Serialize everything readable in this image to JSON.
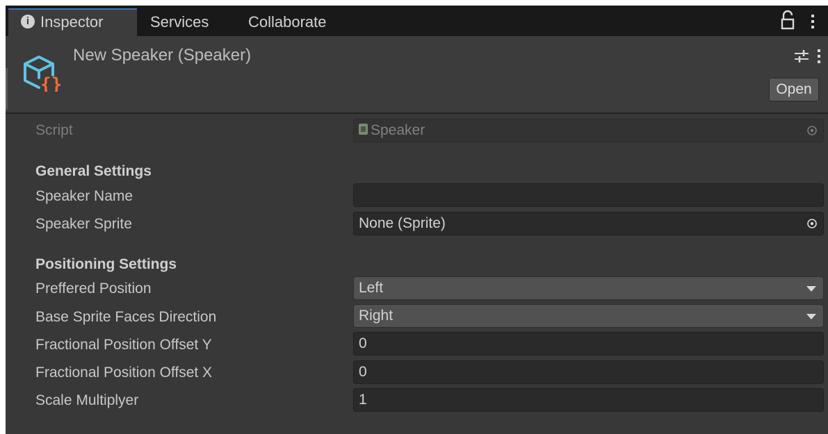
{
  "tabs": [
    {
      "label": "Inspector"
    },
    {
      "label": "Services"
    },
    {
      "label": "Collaborate"
    }
  ],
  "header": {
    "title": "New Speaker (Speaker)",
    "open_label": "Open"
  },
  "script_row": {
    "label": "Script",
    "value": "Speaker"
  },
  "general_settings": {
    "heading": "General Settings",
    "speaker_name": {
      "label": "Speaker Name",
      "value": ""
    },
    "speaker_sprite": {
      "label": "Speaker Sprite",
      "value": "None (Sprite)"
    }
  },
  "positioning_settings": {
    "heading": "Positioning Settings",
    "preferred_position": {
      "label": "Preffered Position",
      "value": "Left"
    },
    "base_sprite_faces": {
      "label": "Base Sprite Faces Direction",
      "value": "Right"
    },
    "offset_y": {
      "label": "Fractional Position Offset Y",
      "value": "0"
    },
    "offset_x": {
      "label": "Fractional Position Offset X",
      "value": "0"
    },
    "scale": {
      "label": "Scale Multiplyer",
      "value": "1"
    }
  },
  "icons": {
    "info": "info-icon",
    "lock": "lock-icon",
    "menu": "kebab-menu-icon",
    "asset": "script-asset-icon",
    "presets": "preset-sliders-icon",
    "picker": "object-picker-icon",
    "dropdown": "dropdown-caret-icon"
  },
  "colors": {
    "panel_bg": "#383838",
    "tabbar_bg": "#191919",
    "active_tab_bg": "#3c3c3c",
    "field_bg": "#2a2a2a",
    "dropdown_bg": "#515151",
    "asset_icon_blue": "#5fc3e4",
    "asset_icon_orange": "#f26b3a"
  }
}
